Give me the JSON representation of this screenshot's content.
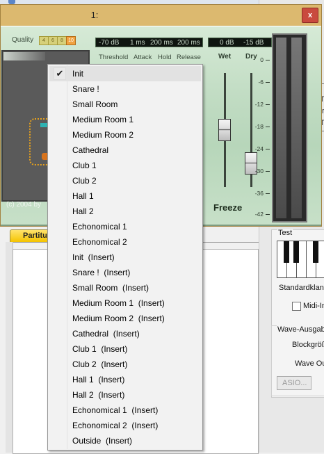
{
  "window": {
    "title": "1:",
    "close_label": "x"
  },
  "plugin": {
    "quality_label": "Quality",
    "quality_options": [
      "4",
      "6",
      "8",
      "10"
    ],
    "quality_selected": "10",
    "lcd_left": [
      "-70 dB",
      "1 ms",
      "200 ms",
      "200 ms"
    ],
    "lcd_right": [
      "0 dB",
      "-15 dB"
    ],
    "knob_labels": [
      "Threshold",
      "Attack",
      "Hold",
      "Release"
    ],
    "wet_label": "Wet",
    "dry_label": "Dry",
    "db_scale": [
      "0",
      "-6",
      "-12",
      "-18",
      "-24",
      "-30",
      "-36",
      "-42"
    ],
    "freeze_label": "Freeze",
    "copyright": "(c) 2004 by"
  },
  "background": {
    "tab_label": "Partitu",
    "test_label": "Test",
    "standard_label": "Standardklang",
    "midi_label": "Midi-In",
    "wave_group_label": "Wave-Ausgab",
    "block_label": "Blockgröß",
    "wave_out_label": "Wave Ou",
    "asio_button": "ASIO...",
    "right_fragments": [
      "|",
      "T",
      "Ir",
      "T",
      "/"
    ]
  },
  "menu": {
    "items": [
      {
        "label": "Init",
        "checked": true
      },
      {
        "label": "Snare !"
      },
      {
        "label": "Small Room"
      },
      {
        "label": "Medium Room 1"
      },
      {
        "label": "Medium Room 2"
      },
      {
        "label": "Cathedral"
      },
      {
        "label": "Club 1"
      },
      {
        "label": "Club 2"
      },
      {
        "label": "Hall 1"
      },
      {
        "label": "Hall 2"
      },
      {
        "label": "Echonomical 1"
      },
      {
        "label": "Echonomical 2"
      },
      {
        "label": "Init  (Insert)"
      },
      {
        "label": "Snare !  (Insert)"
      },
      {
        "label": "Small Room  (Insert)"
      },
      {
        "label": "Medium Room 1  (Insert)"
      },
      {
        "label": "Medium Room 2  (Insert)"
      },
      {
        "label": "Cathedral  (Insert)"
      },
      {
        "label": "Club 1  (Insert)"
      },
      {
        "label": "Club 2  (Insert)"
      },
      {
        "label": "Hall 1  (Insert)"
      },
      {
        "label": "Hall 2  (Insert)"
      },
      {
        "label": "Echonomical 1  (Insert)"
      },
      {
        "label": "Echonomical 2  (Insert)"
      },
      {
        "label": "Outside  (Insert)"
      }
    ],
    "check_glyph": "✔"
  }
}
